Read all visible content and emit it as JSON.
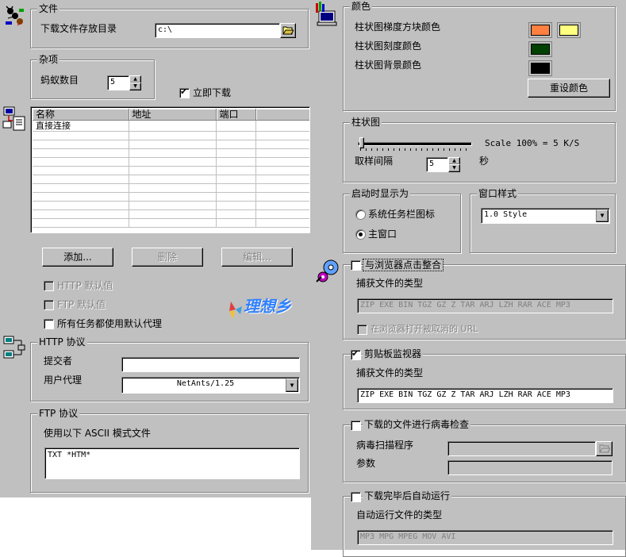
{
  "file": {
    "title": "文件",
    "dir_label": "下载文件存放目录",
    "dir_value": "c:\\"
  },
  "misc": {
    "title": "杂项",
    "ants_label": "蚂蚁数目",
    "ants_value": "5",
    "immediate_label": "立即下载",
    "immediate_checked": true
  },
  "proxy": {
    "columns": [
      "名称",
      "地址",
      "端口"
    ],
    "rows": [
      [
        "直接连接",
        "",
        ""
      ],
      [
        "",
        "",
        ""
      ],
      [
        "",
        "",
        ""
      ],
      [
        "",
        "",
        ""
      ],
      [
        "",
        "",
        ""
      ],
      [
        "",
        "",
        ""
      ],
      [
        "",
        "",
        ""
      ],
      [
        "",
        "",
        ""
      ],
      [
        "",
        "",
        ""
      ],
      [
        "",
        "",
        ""
      ],
      [
        "",
        "",
        ""
      ],
      [
        "",
        "",
        ""
      ]
    ],
    "add_label": "添加...",
    "delete_label": "删除",
    "edit_label": "编辑...",
    "http_default_label": "HTTP 默认值",
    "ftp_default_label": "FTP 默认值",
    "all_tasks_label": "所有任务都使用默认代理",
    "watermark": "理想乡"
  },
  "http": {
    "title": "HTTP 协议",
    "submitter_label": "提交者",
    "submitter_value": "",
    "agent_label": "用户代理",
    "agent_value": "NetAnts/1.25"
  },
  "ftp": {
    "title": "FTP 协议",
    "ascii_label": "使用以下 ASCII 模式文件",
    "ascii_value": "TXT *HTM*"
  },
  "colors": {
    "title": "颜色",
    "gradient_label": "柱状图梯度方块颜色",
    "scale_label": "柱状图刻度颜色",
    "bg_label": "柱状图背景颜色",
    "reset_label": "重设颜色",
    "gradient_color1": "#ff8040",
    "gradient_color2": "#ffff80",
    "scale_color": "#004000",
    "bg_color": "#000000"
  },
  "bar": {
    "title": "柱状图",
    "scale_text": "Scale 100% = 5 K/S",
    "slider_value": 0,
    "sample_label": "取样间隔",
    "sample_value": "5",
    "sample_unit": "秒"
  },
  "startup": {
    "title": "启动时显示为",
    "tray_label": "系统任务栏图标",
    "main_label": "主窗口",
    "selected": "main"
  },
  "window_style": {
    "title": "窗口样式",
    "value": "1.0 Style"
  },
  "browser": {
    "integrate_label": "与浏览器点击整合",
    "integrate_checked": false,
    "types_label": "捕获文件的类型",
    "types_value": "ZIP EXE BIN TGZ GZ Z TAR ARJ LZH RAR ACE MP3",
    "cancel_label": "在浏览器打开被取消的 URL"
  },
  "clipboard": {
    "monitor_label": "剪贴板监视器",
    "monitor_checked": true,
    "types_label": "捕获文件的类型",
    "types_value": "ZIP EXE BIN TGZ GZ Z TAR ARJ LZH RAR ACE MP3"
  },
  "virus": {
    "check_label": "下载的文件进行病毒检查",
    "scanner_label": "病毒扫描程序",
    "params_label": "参数"
  },
  "autorun": {
    "run_label": "下载完毕后自动运行",
    "types_label": "自动运行文件的类型",
    "types_value": "MP3 MPG MPEG MOV AVI"
  }
}
